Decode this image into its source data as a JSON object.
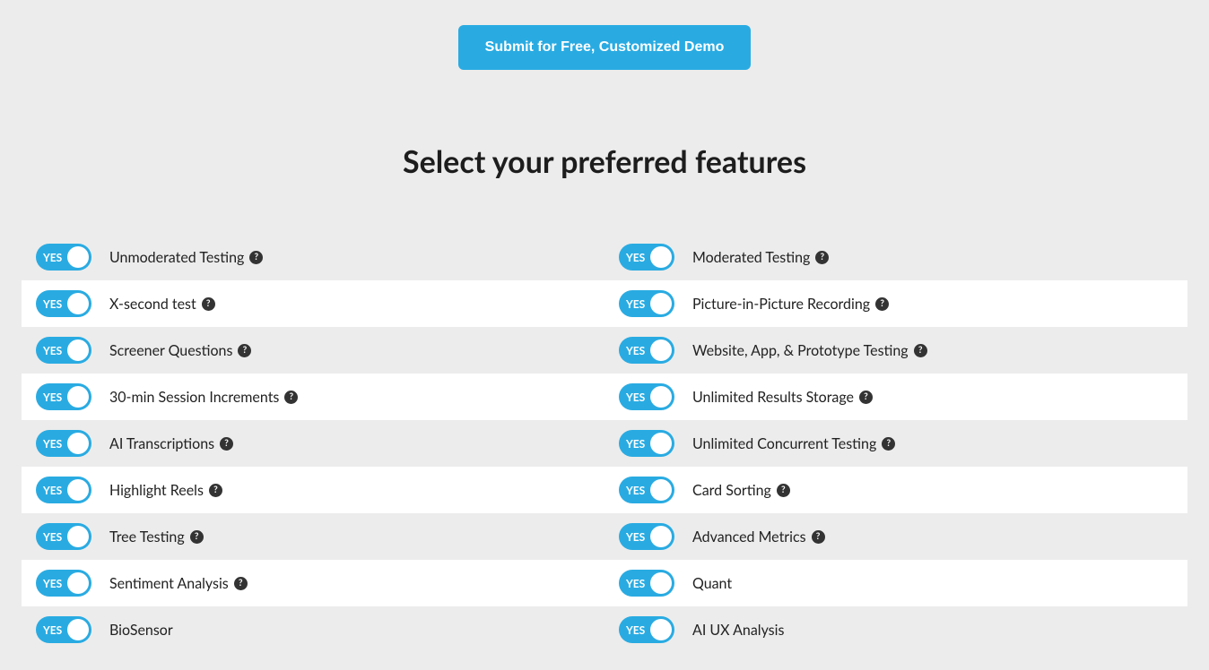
{
  "submit_label": "Submit for Free, Customized Demo",
  "heading": "Select your preferred features",
  "toggle_on_text": "YES",
  "help_glyph": "?",
  "features": {
    "left": [
      {
        "label": "Unmoderated Testing",
        "help": true
      },
      {
        "label": "X-second test",
        "help": true
      },
      {
        "label": "Screener Questions",
        "help": true
      },
      {
        "label": "30-min Session Increments",
        "help": true
      },
      {
        "label": "AI Transcriptions",
        "help": true
      },
      {
        "label": "Highlight Reels",
        "help": true
      },
      {
        "label": "Tree Testing",
        "help": true
      },
      {
        "label": "Sentiment Analysis",
        "help": true
      },
      {
        "label": "BioSensor",
        "help": false
      }
    ],
    "right": [
      {
        "label": "Moderated Testing",
        "help": true
      },
      {
        "label": "Picture-in-Picture Recording",
        "help": true
      },
      {
        "label": "Website, App, & Prototype Testing",
        "help": true
      },
      {
        "label": "Unlimited Results Storage",
        "help": true
      },
      {
        "label": "Unlimited Concurrent Testing",
        "help": true
      },
      {
        "label": "Card Sorting",
        "help": true
      },
      {
        "label": "Advanced Metrics",
        "help": true
      },
      {
        "label": "Quant",
        "help": false
      },
      {
        "label": "AI UX Analysis",
        "help": false
      }
    ]
  }
}
